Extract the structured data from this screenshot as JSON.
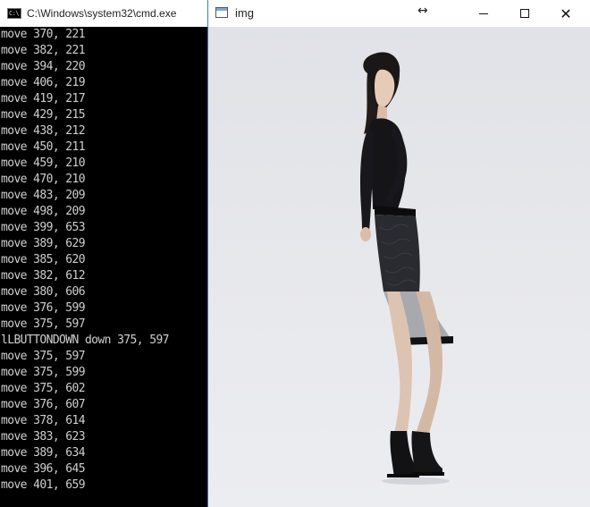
{
  "cmd_window": {
    "title": "C:\\Windows\\system32\\cmd.exe",
    "icon_text": "C:\\",
    "lines": [
      "move 370, 221",
      "move 382, 221",
      "move 394, 220",
      "move 406, 219",
      "move 419, 217",
      "move 429, 215",
      "move 438, 212",
      "move 450, 211",
      "move 459, 210",
      "move 470, 210",
      "move 483, 209",
      "move 498, 209",
      "move 399, 653",
      "move 389, 629",
      "move 385, 620",
      "move 382, 612",
      "move 380, 606",
      "move 376, 599",
      "move 375, 597",
      "lLBUTTONDOWN down 375, 597",
      "move 375, 597",
      "move 375, 599",
      "move 375, 602",
      "move 376, 607",
      "move 378, 614",
      "move 383, 623",
      "move 389, 634",
      "move 396, 645",
      "move 401, 659"
    ]
  },
  "img_window": {
    "title": "img",
    "resize_glyph": "↔",
    "close_glyph": "✕",
    "icons": {
      "app": "window-icon",
      "resize": "resize-horizontal-icon",
      "minimize": "minimize-icon",
      "maximize": "maximize-icon",
      "close": "close-icon"
    }
  },
  "colors": {
    "console_bg": "#000000",
    "console_text": "#cfcfcf",
    "canvas_bg": "#e4e5ea",
    "active_border": "#4a78c0"
  }
}
